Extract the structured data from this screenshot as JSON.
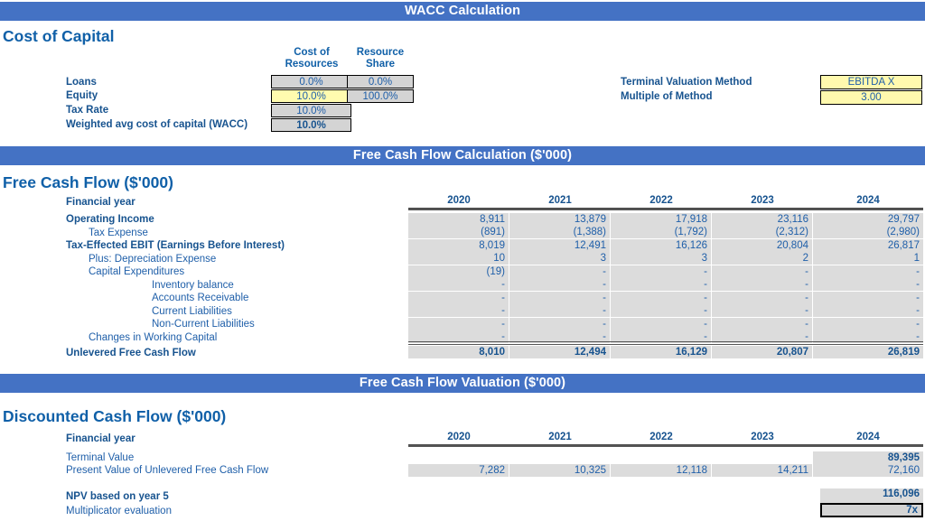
{
  "banners": {
    "wacc": "WACC Calculation",
    "fcf_calc": "Free Cash Flow Calculation ($'000)",
    "fcf_val": "Free Cash Flow Valuation ($'000)"
  },
  "colors": {
    "banner_blue": "#4472C4",
    "text_blue": "#1F5FA9",
    "heading_blue": "#1060A8",
    "input_yellow": "#FFF9AE",
    "cell_gray": "#DCDCDC"
  },
  "cost_of_capital": {
    "title": "Cost of Capital",
    "col_headers": [
      "Cost of Resources",
      "Resource Share"
    ],
    "col_header_lines": [
      [
        "Cost of",
        "Resources"
      ],
      [
        "Resource",
        "Share"
      ]
    ],
    "rows": [
      {
        "label": "Loans",
        "cost": "0.0%",
        "share": "0.0%",
        "cost_input": false
      },
      {
        "label": "Equity",
        "cost": "10.0%",
        "share": "100.0%",
        "cost_input": true
      },
      {
        "label": "Tax Rate",
        "cost": "10.0%",
        "share": "",
        "cost_input": false
      },
      {
        "label": "Weighted avg cost of capital (WACC)",
        "cost": "10.0%",
        "share": "",
        "cost_input": false
      }
    ]
  },
  "terminal": {
    "method_label": "Terminal Valuation Method",
    "method_value": "EBITDA X",
    "multiple_label": "Multiple of Method",
    "multiple_value": "3.00"
  },
  "free_cash_flow": {
    "title": "Free Cash Flow ($'000)",
    "year_label": "Financial year",
    "years": [
      "2020",
      "2021",
      "2022",
      "2023",
      "2024"
    ],
    "rows": [
      {
        "label": "Operating Income",
        "indent": 0,
        "bold": true,
        "values": [
          "8,911",
          "13,879",
          "17,918",
          "23,116",
          "29,797"
        ]
      },
      {
        "label": "Tax Expense",
        "indent": 1,
        "bold": false,
        "values": [
          "(891)",
          "(1,388)",
          "(1,792)",
          "(2,312)",
          "(2,980)"
        ]
      },
      {
        "label": "Tax-Effected EBIT (Earnings Before Interest)",
        "indent": 0,
        "bold": true,
        "values": [
          "8,019",
          "12,491",
          "16,126",
          "20,804",
          "26,817"
        ]
      },
      {
        "label": "Plus: Depreciation Expense",
        "indent": 1,
        "bold": false,
        "values": [
          "10",
          "3",
          "3",
          "2",
          "1"
        ]
      },
      {
        "label": "Capital Expenditures",
        "indent": 1,
        "bold": false,
        "values": [
          "(19)",
          "-",
          "-",
          "-",
          "-"
        ]
      },
      {
        "label": "Inventory balance",
        "indent": 2,
        "bold": false,
        "values": [
          "-",
          "-",
          "-",
          "-",
          "-"
        ]
      },
      {
        "label": "Accounts Receivable",
        "indent": 2,
        "bold": false,
        "values": [
          "-",
          "-",
          "-",
          "-",
          "-"
        ]
      },
      {
        "label": "Current Liabilities",
        "indent": 2,
        "bold": false,
        "values": [
          "-",
          "-",
          "-",
          "-",
          "-"
        ]
      },
      {
        "label": "Non-Current Liabilities",
        "indent": 2,
        "bold": false,
        "values": [
          "-",
          "-",
          "-",
          "-",
          "-"
        ]
      },
      {
        "label": "Changes in Working Capital",
        "indent": 1,
        "bold": false,
        "values": [
          "-",
          "-",
          "-",
          "-",
          "-"
        ]
      }
    ],
    "total": {
      "label": "Unlevered Free Cash Flow",
      "values": [
        "8,010",
        "12,494",
        "16,129",
        "20,807",
        "26,819"
      ]
    }
  },
  "discounted_cash_flow": {
    "title": "Discounted Cash Flow ($'000)",
    "year_label": "Financial year",
    "years": [
      "2020",
      "2021",
      "2022",
      "2023",
      "2024"
    ],
    "rows": [
      {
        "label": "Terminal Value",
        "bold": true,
        "values": [
          "",
          "",
          "",
          "",
          "89,395"
        ]
      },
      {
        "label": "Present Value of Unlevered Free Cash Flow",
        "bold": false,
        "values": [
          "7,282",
          "10,325",
          "12,118",
          "14,211",
          "72,160"
        ]
      }
    ],
    "npv": {
      "label": "NPV based on year 5",
      "value": "116,096"
    },
    "multiplicator": {
      "label": "Multiplicator evaluation",
      "value": "7x"
    }
  }
}
